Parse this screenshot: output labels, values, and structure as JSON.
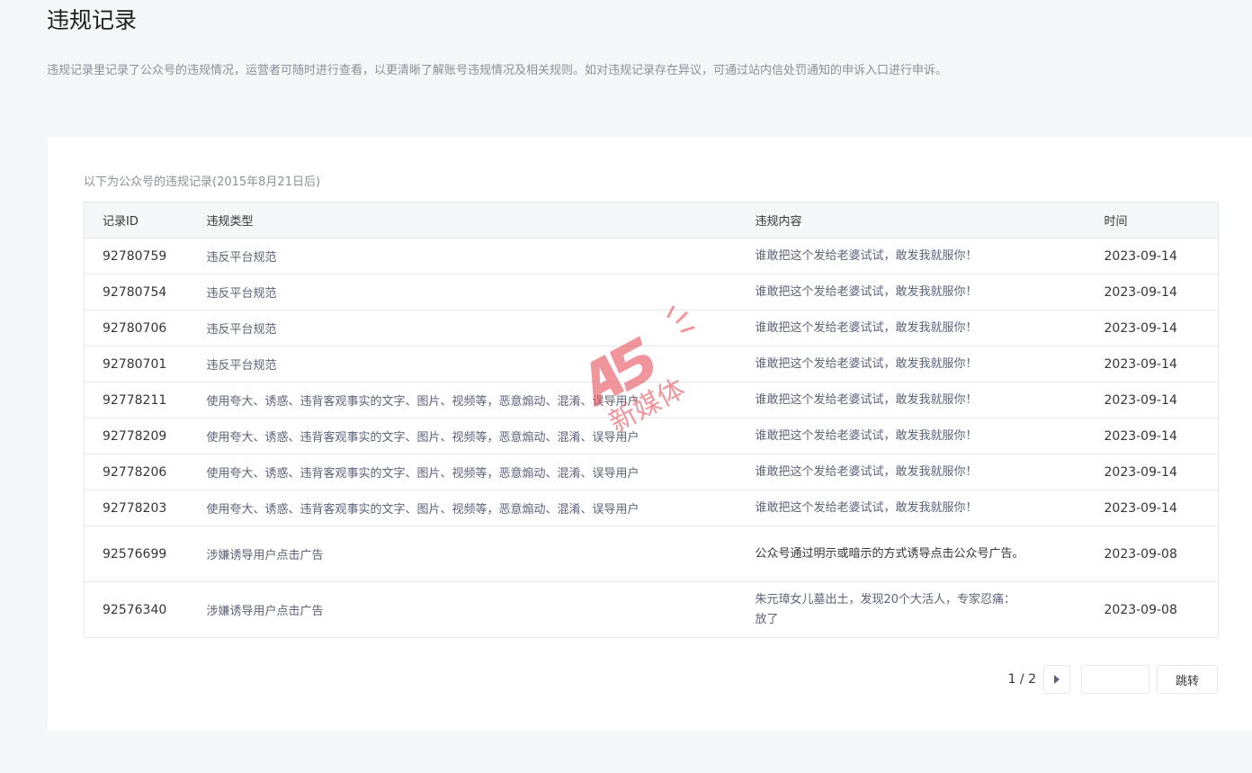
{
  "page": {
    "title": "违规记录",
    "description": "违规记录里记录了公众号的违规情况，运营者可随时进行查看，以更清晰了解账号违规情况及相关规则。如对违规记录存在异议，可通过站内信处罚通知的申诉入口进行申诉。"
  },
  "card": {
    "note": "以下为公众号的违规记录(2015年8月21日后)"
  },
  "table": {
    "headers": {
      "id": "记录ID",
      "type": "违规类型",
      "content": "违规内容",
      "time": "时间"
    },
    "rows": [
      {
        "id": "92780759",
        "type": "违反平台规范",
        "content": "谁敢把这个发给老婆试试，敢发我就服你！",
        "time": "2023-09-14"
      },
      {
        "id": "92780754",
        "type": "违反平台规范",
        "content": "谁敢把这个发给老婆试试，敢发我就服你！",
        "time": "2023-09-14"
      },
      {
        "id": "92780706",
        "type": "违反平台规范",
        "content": "谁敢把这个发给老婆试试，敢发我就服你！",
        "time": "2023-09-14"
      },
      {
        "id": "92780701",
        "type": "违反平台规范",
        "content": "谁敢把这个发给老婆试试，敢发我就服你！",
        "time": "2023-09-14"
      },
      {
        "id": "92778211",
        "type": "使用夸大、诱惑、违背客观事实的文字、图片、视频等，恶意煽动、混淆、误导用户",
        "content": "谁敢把这个发给老婆试试，敢发我就服你！",
        "time": "2023-09-14"
      },
      {
        "id": "92778209",
        "type": "使用夸大、诱惑、违背客观事实的文字、图片、视频等，恶意煽动、混淆、误导用户",
        "content": "谁敢把这个发给老婆试试，敢发我就服你！",
        "time": "2023-09-14"
      },
      {
        "id": "92778206",
        "type": "使用夸大、诱惑、违背客观事实的文字、图片、视频等，恶意煽动、混淆、误导用户",
        "content": "谁敢把这个发给老婆试试，敢发我就服你！",
        "time": "2023-09-14"
      },
      {
        "id": "92778203",
        "type": "使用夸大、诱惑、违背客观事实的文字、图片、视频等，恶意煽动、混淆、误导用户",
        "content": "谁敢把这个发给老婆试试，敢发我就服你！",
        "time": "2023-09-14"
      },
      {
        "id": "92576699",
        "type": "涉嫌诱导用户点击广告",
        "content": "公众号通过明示或暗示的方式诱导点击公众号广告。",
        "time": "2023-09-08"
      },
      {
        "id": "92576340",
        "type": "涉嫌诱导用户点击广告",
        "content": "朱元璋女儿墓出土，发现20个大活人，专家忍痛：放了",
        "time": "2023-09-08"
      }
    ]
  },
  "pagination": {
    "page_text": "1 / 2",
    "next_icon": "triangle-right-icon",
    "input_value": "",
    "jump_label": "跳转"
  },
  "watermark": {
    "logo": "A5",
    "text": "新媒体",
    "color": "#e8505b"
  }
}
